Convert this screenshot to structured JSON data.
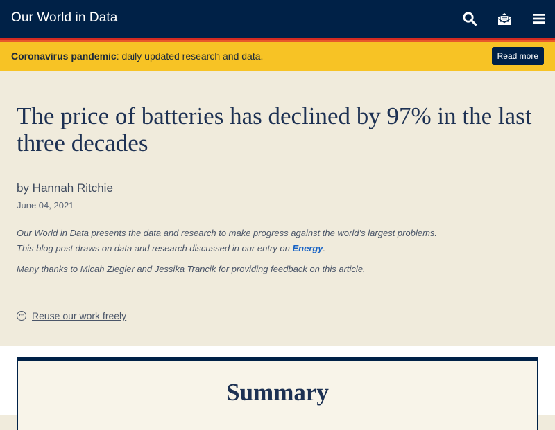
{
  "header": {
    "brand": "Our World in Data",
    "icons": [
      "search-icon",
      "subscribe-icon",
      "menu-icon"
    ]
  },
  "banner": {
    "bold_text": "Coronavirus pandemic",
    "text": ": daily updated research and data.",
    "button_label": "Read more"
  },
  "article": {
    "title": "The price of batteries has declined by 97% in the last three decades",
    "byline": "by Hannah Ritchie",
    "date": "June 04, 2021",
    "intro_line1": "Our World in Data presents the data and research to make progress against the world’s largest problems.",
    "intro_line2_prefix": "This blog post draws on data and research discussed in our entry on ",
    "intro_link": "Energy",
    "intro_line2_suffix": ".",
    "thanks": "Many thanks to Micah Ziegler and Jessika Trancik for providing feedback on this article.",
    "reuse_icon_text": "cc",
    "reuse_label": "Reuse our work freely"
  },
  "summary": {
    "heading": "Summary"
  },
  "colors": {
    "header_bg": "#002147",
    "banner_bg": "#f7c325",
    "page_bg": "#f0ebdc",
    "title": "#1d3153",
    "link": "#1863c5"
  }
}
